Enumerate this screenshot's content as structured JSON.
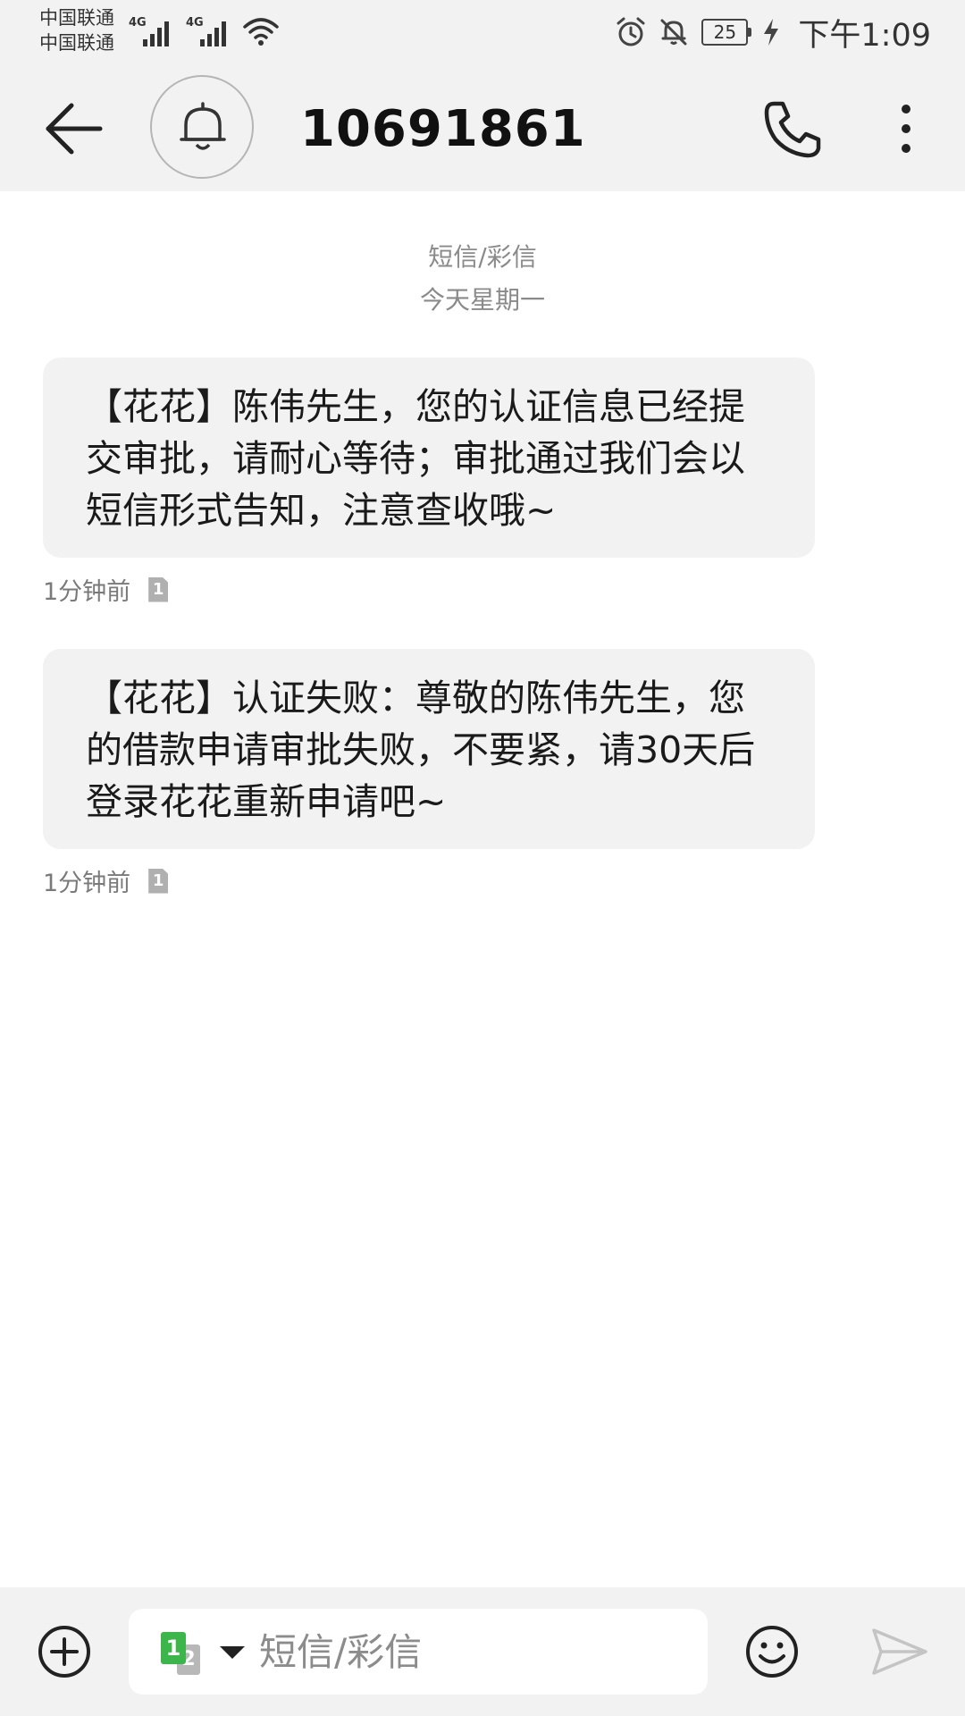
{
  "status_bar": {
    "carrier_1": "中国联通",
    "carrier_2": "中国联通",
    "network_1": "4G",
    "network_2": "4G",
    "battery_level": "25",
    "time": "下午1:09",
    "icons": [
      "alarm-icon",
      "bell-off-icon",
      "battery-icon",
      "charging-icon",
      "wifi-icon"
    ]
  },
  "app_bar": {
    "back_icon": "arrow-left-icon",
    "avatar_icon": "bell-icon",
    "title": "10691861",
    "call_icon": "phone-icon",
    "more_icon": "more-vertical-icon"
  },
  "conversation": {
    "type_label": "短信/彩信",
    "date_label": "今天星期一",
    "messages": [
      {
        "text": "【花花】陈伟先生，您的认证信息已经提交审批，请耐心等待；审批通过我们会以短信形式告知，注意查收哦~",
        "time": "1分钟前",
        "sim": "1"
      },
      {
        "text": "【花花】认证失败：尊敬的陈伟先生，您的借款申请审批失败，不要紧，请30天后登录花花重新申请吧~",
        "time": "1分钟前",
        "sim": "1"
      }
    ]
  },
  "composer": {
    "add_icon": "plus-circle-icon",
    "sim_primary": "1",
    "sim_secondary": "2",
    "placeholder": "短信/彩信",
    "value": "",
    "emoji_icon": "smiley-icon",
    "send_icon": "send-icon"
  },
  "colors": {
    "bar_background": "#f2f2f2",
    "bubble_background": "#f2f2f2",
    "sim1_green": "#3cb54a",
    "muted_text": "#8a8a8a"
  }
}
